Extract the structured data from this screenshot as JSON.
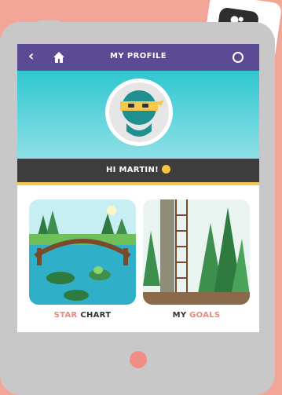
{
  "header": {
    "back_icon": "chevron-left-icon",
    "home_icon": "home-icon",
    "title": "MY PROFILE",
    "menu_icon": "menu-icon"
  },
  "profile": {
    "greeting": "HI MARTIN!",
    "avatar_icon": "ninja-avatar-icon"
  },
  "cards": [
    {
      "label_part1": "STAR",
      "label_part2": " CHART",
      "illustration": "pond-bridge-frog"
    },
    {
      "label_part1": "MY",
      "label_part2": " GOALS",
      "illustration": "forest-ladder"
    }
  ],
  "colors": {
    "background": "#f3a598",
    "header": "#5b4a94",
    "banner": "#2fc7cf",
    "greeting_bar": "#3d3d3d",
    "accent": "#e98a7c",
    "strip": "#f2c94c"
  }
}
